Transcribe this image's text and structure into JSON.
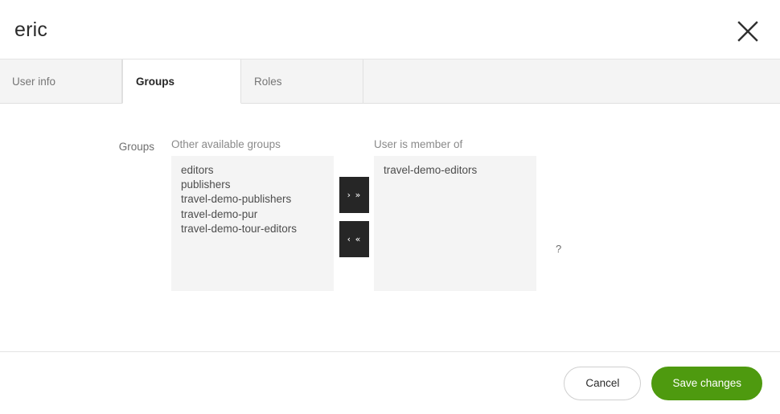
{
  "dialog": {
    "title": "eric",
    "close_icon": "close-icon"
  },
  "tabs": [
    {
      "label": "User info",
      "active": false
    },
    {
      "label": "Groups",
      "active": true
    },
    {
      "label": "Roles",
      "active": false
    }
  ],
  "form": {
    "field_label": "Groups",
    "help_icon_label": "?",
    "available": {
      "caption": "Other available groups",
      "options": [
        "editors",
        "publishers",
        "travel-demo-publishers",
        "travel-demo-pur",
        "travel-demo-tour-editors"
      ]
    },
    "member_of": {
      "caption": "User is member of",
      "options": [
        "travel-demo-editors"
      ]
    },
    "transfer": {
      "add_label": "› »",
      "remove_label": "‹ «"
    }
  },
  "footer": {
    "cancel_label": "Cancel",
    "save_label": "Save changes"
  },
  "colors": {
    "accent_green": "#4e9a0f",
    "panel_gray": "#f4f4f4",
    "dark_button": "#262626"
  }
}
